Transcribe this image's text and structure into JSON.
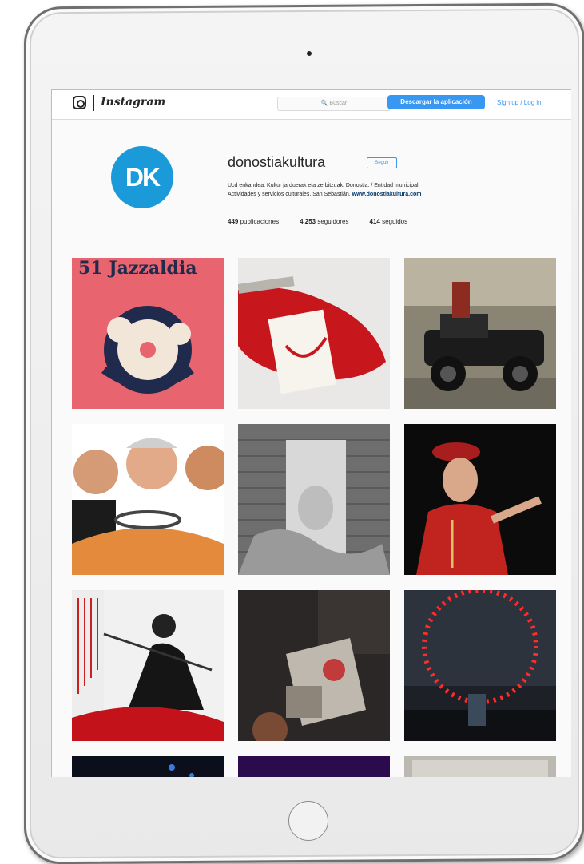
{
  "header": {
    "wordmark": "Instagram",
    "search_placeholder": "🔍 Buscar",
    "download_button": "Descargar la aplicación",
    "signup_link": "Sign up / Log in"
  },
  "profile": {
    "avatar_text": "DK",
    "avatar_color": "#1a9ad8",
    "username": "donostiakultura",
    "follow_button": "Seguir",
    "bio_line1": "Ucd enkandea. Kultur jarduerak eta zerbitzuak. Donostia. / Entidad municipal.",
    "bio_line2": "Actividades y servicios culturales. San Sebastián.",
    "bio_link": "www.donostiakultura.com",
    "posts_count": "449",
    "posts_label": "publicaciones",
    "followers_count": "4.253",
    "followers_label": "seguidores",
    "following_count": "414",
    "following_label": "seguidos"
  },
  "posts": [
    {
      "name": "post-jazzaldia",
      "title": "51 Jazzaldia"
    },
    {
      "name": "post-book-red-cloth"
    },
    {
      "name": "post-vintage-car"
    },
    {
      "name": "post-comedians"
    },
    {
      "name": "post-book-portrait"
    },
    {
      "name": "post-red-costume-actor"
    },
    {
      "name": "post-samurai-poster"
    },
    {
      "name": "post-dance-poster"
    },
    {
      "name": "post-concert-red-circle"
    },
    {
      "name": "post-partial-dark"
    },
    {
      "name": "post-partial-purple"
    },
    {
      "name": "post-partial-paper"
    }
  ]
}
